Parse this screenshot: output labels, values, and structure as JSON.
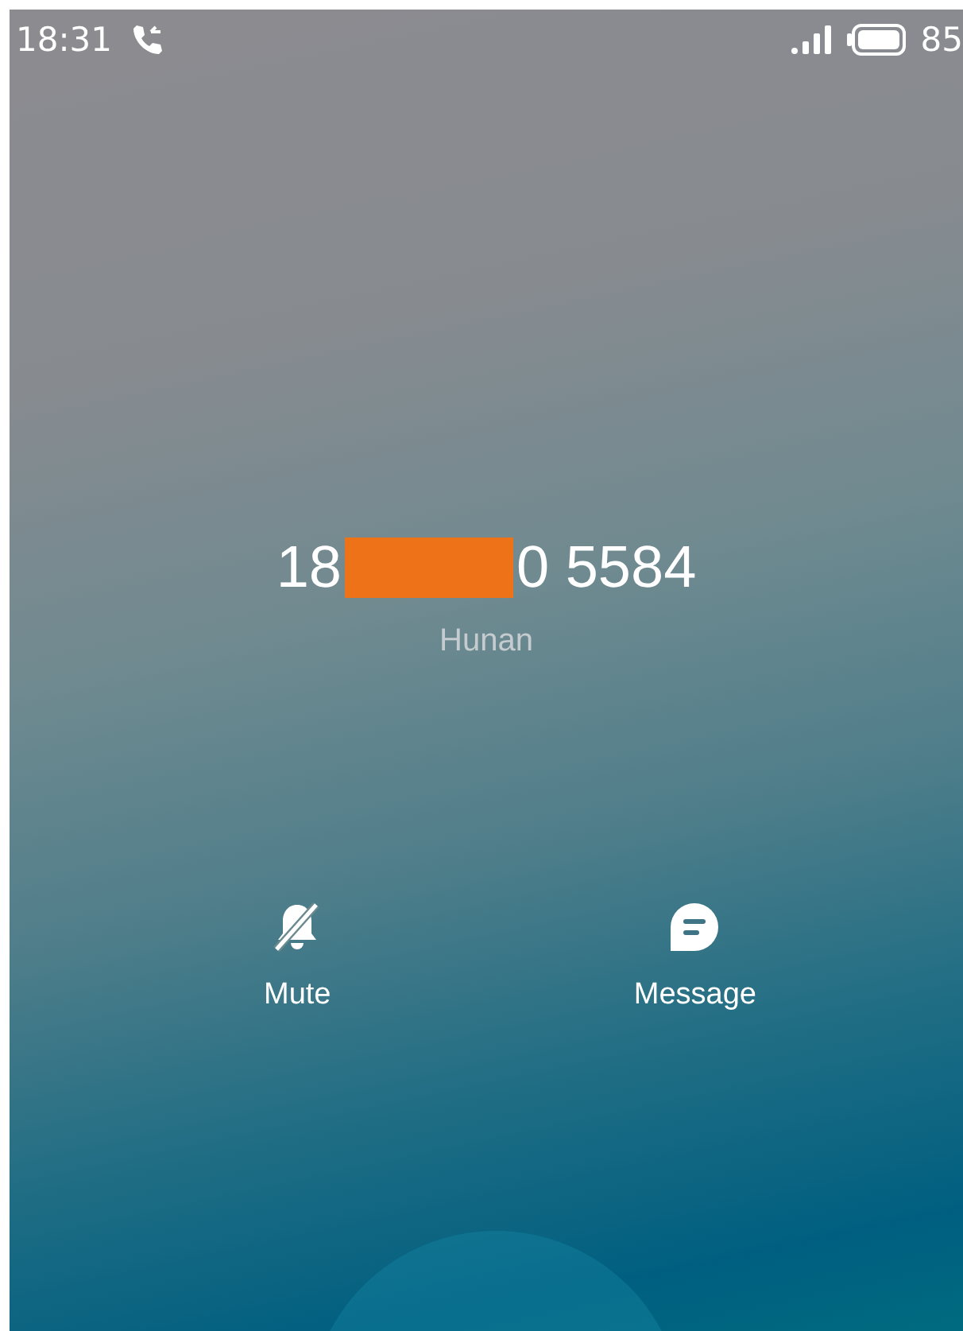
{
  "status_bar": {
    "time": "18:31",
    "battery": "85"
  },
  "caller": {
    "number_start": "18",
    "number_end": "0 5584",
    "location": "Hunan"
  },
  "actions": [
    {
      "kind": "mute",
      "label": "Mute"
    },
    {
      "kind": "message",
      "label": "Message"
    }
  ]
}
